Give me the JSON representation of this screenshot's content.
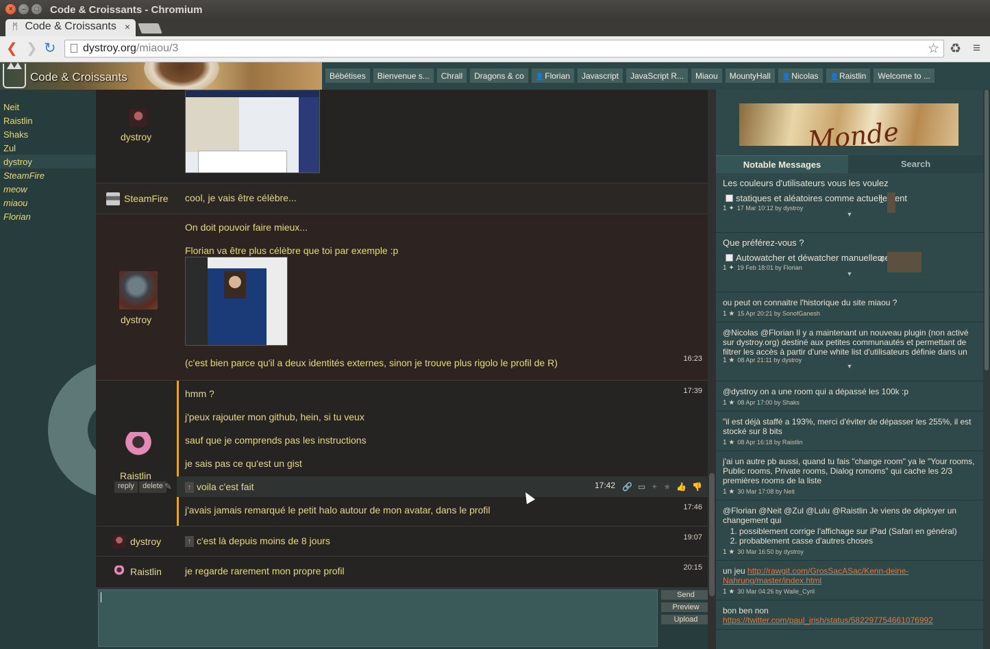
{
  "window": {
    "title": "Code & Croissants - Chromium"
  },
  "browser": {
    "tab_title": "Code & Croissants",
    "url_host": "dystroy.org",
    "url_path": "/miaou/3"
  },
  "room": {
    "title": "Code & Croissants"
  },
  "room_tabs": [
    {
      "label": "Bébétises",
      "person": false
    },
    {
      "label": "Bienvenue s...",
      "person": false
    },
    {
      "label": "Chrall",
      "person": false
    },
    {
      "label": "Dragons & co",
      "person": false
    },
    {
      "label": "Florian",
      "person": true
    },
    {
      "label": "Javascript",
      "person": false
    },
    {
      "label": "JavaScript R...",
      "person": false
    },
    {
      "label": "Miaou",
      "person": false
    },
    {
      "label": "MountyHall",
      "person": false
    },
    {
      "label": "Nicolas",
      "person": true
    },
    {
      "label": "Raistlin",
      "person": true
    },
    {
      "label": "Welcome to ...",
      "person": false
    }
  ],
  "users": [
    {
      "name": "Neit",
      "online": true
    },
    {
      "name": "Raistlin",
      "online": true
    },
    {
      "name": "Shaks",
      "online": true
    },
    {
      "name": "Zul",
      "online": true
    },
    {
      "name": "dystroy",
      "online": true
    },
    {
      "name": "SteamFire",
      "online": false
    },
    {
      "name": "meow",
      "online": false
    },
    {
      "name": "miaou",
      "online": false
    },
    {
      "name": "Florian",
      "online": false
    }
  ],
  "messages": {
    "m1": {
      "author": "dystroy"
    },
    "m2": {
      "author": "SteamFire",
      "text": "cool, je vais être célèbre..."
    },
    "m3": {
      "author": "dystroy",
      "lines": [
        "On doit pouvoir faire mieux...",
        "Florian va être plus célèbre que toi par exemple :p"
      ],
      "tail": "(c'est bien parce qu'il a deux identités externes, sinon je trouve plus rigolo le profil de R)",
      "time": "16:23"
    },
    "m4": {
      "author": "Raistlin",
      "lines": [
        "hmm ?",
        "j'peux rajouter mon github, hein, si tu veux",
        "sauf que je comprends pas les instructions",
        "je sais pas ce qu'est un gist"
      ],
      "time_first": "17:39",
      "hover_text": "voila c'est fait",
      "hover_time": "17:42",
      "last": "j'avais jamais remarqué le petit halo autour de mon avatar, dans le profil",
      "last_time": "17:46",
      "reply": "reply",
      "delete": "delete"
    },
    "m5": {
      "author": "dystroy",
      "text": "c'est là depuis moins de 8 jours",
      "time": "19:07"
    },
    "m6": {
      "author": "Raistlin",
      "text": "je regarde rarement mon propre profil",
      "time": "20:15"
    }
  },
  "input": {
    "send": "Send",
    "preview": "Preview",
    "upload": "Upload"
  },
  "panel": {
    "tab_notable": "Notable Messages",
    "tab_search": "Search",
    "header_image_text": "Monde",
    "notables": {
      "n1": {
        "text": "Les couleurs d'utilisateurs vous les voulez",
        "option": "statiques et aléatoires comme actuellement",
        "count": "1",
        "meta_count": "1",
        "meta": "17 Mar 10:12 by dystroy"
      },
      "n2": {
        "text": "Que préférez-vous ?",
        "option": "Autowatcher et déwatcher manuellement",
        "count": "4",
        "meta_count": "1",
        "meta": "19 Feb 18:01 by Florian"
      },
      "n3": {
        "text": "ou peut on connaitre l'historique du site miaou ?",
        "meta_count": "1",
        "meta": "15 Apr 20:21 by SonofGanesh"
      },
      "n4": {
        "text": "@Nicolas @Florian Il y a maintenant un nouveau plugin (non activé sur dystroy.org) destiné aux petites communautés et permettant de filtrer les accès à partir d'une white list d'utilisateurs définie dans un fichier CSV.",
        "meta_count": "1",
        "meta": "08 Apr 21:11 by dystroy"
      },
      "n5": {
        "text": "@dystroy on a une room qui a dépassé les 100k :p",
        "meta_count": "1",
        "meta": "08 Apr 17:00 by Shaks"
      },
      "n6": {
        "text": "\"il est déjà staffé a 193%, merci d'éviter de dépasser les 255%, il est stocké sur 8 bits",
        "meta_count": "1",
        "meta": "08 Apr 16:18 by Raistlin"
      },
      "n7": {
        "text": "j'ai un autre pb aussi, quand tu fais \"change room\" ya le \"Your rooms, Public rooms, Private rooms, Dialog romoms\" qui cache les 2/3 premières rooms de la liste",
        "meta_count": "1",
        "meta": "30 Mar 17:08 by Neit"
      },
      "n8": {
        "text": "@Florian @Neit @Zul @Lulu @Raistlin Je viens de déployer un changement qui",
        "items": [
          "possiblement corrige l'affichage sur iPad (Safari en général)",
          "probablement casse d'autres choses"
        ],
        "meta_count": "1",
        "meta": "30 Mar 16:50 by dystroy"
      },
      "n9": {
        "prefix": "un jeu ",
        "link": "http://rawgit.com/GrosSacASac/Kenn-deine-Nahrung/master/index.html",
        "meta_count": "1",
        "meta": "30 Mar 04:26 by Walle_Cyril"
      },
      "n10": {
        "text": "bon ben non",
        "link": "https://twitter.com/paul_irish/status/582297754661076992"
      }
    }
  },
  "colors": {
    "accent_text": "#e6d982",
    "panel_bg": "#2f4849",
    "highlight_bar": "#e2a23c"
  }
}
